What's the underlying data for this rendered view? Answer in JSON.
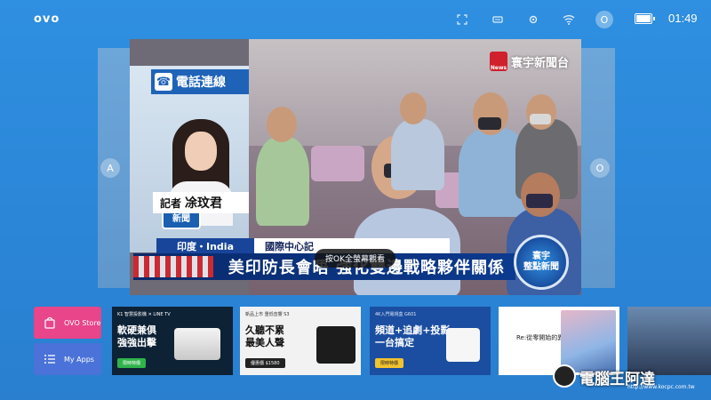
{
  "topbar": {
    "logo": "ovo",
    "user_initial": "O",
    "time": "01:49",
    "icons": [
      "screenshot-icon",
      "storage-icon",
      "settings-icon",
      "wifi-icon",
      "user-icon",
      "battery-icon"
    ]
  },
  "side_buttons": {
    "left": "A",
    "right": "O"
  },
  "video": {
    "channel": "寰宇新聞台",
    "channel_logo_text": "News",
    "phone_tag": "電話連線",
    "mic_text": "寰宇\n新聞",
    "reporter_prefix": "記者",
    "reporter_name": "凃玟君",
    "country_tag": "印度・India",
    "center_tag": "國際中心記",
    "headline": "美印防長會晤 強化雙邊戰略夥伴關係",
    "badge_line1": "寰宇",
    "badge_line2": "整點新聞",
    "toast": "按OK全螢幕觀看"
  },
  "apps": {
    "store_label": "OVO Store",
    "myapps_label": "My Apps"
  },
  "promos": [
    {
      "small": "K1 智慧投影機 ✕ LINE TV",
      "head": "軟硬兼俱\n強強出擊",
      "button": "限時特價"
    },
    {
      "small": "新品上市  重低音響 S3",
      "head": "久聽不累\n最美人聲",
      "button": "優惠價 $1580"
    },
    {
      "small": "4K入門電視盒 G601",
      "head": "頻道+追劇+投影\n一台搞定",
      "button": "限時特價"
    },
    {
      "small": "Re:從零開始的異世界生活"
    },
    {}
  ],
  "watermark": {
    "title": "電腦王阿達",
    "url": "http://www.kocpc.com.tw"
  }
}
